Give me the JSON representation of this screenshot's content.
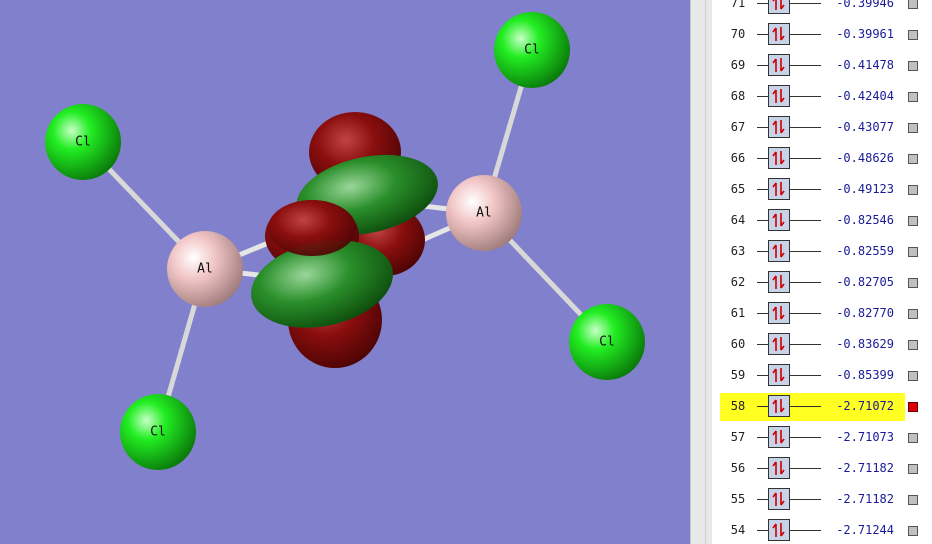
{
  "viewer": {
    "background": "#8080cc",
    "atoms": [
      {
        "id": "cl-top-left",
        "label": "Cl",
        "color": "green"
      },
      {
        "id": "cl-top-right",
        "label": "Cl",
        "color": "green"
      },
      {
        "id": "al-left",
        "label": "Al",
        "color": "pink"
      },
      {
        "id": "al-right",
        "label": "Al",
        "color": "pink"
      },
      {
        "id": "cl-bottom-right",
        "label": "Cl",
        "color": "green"
      },
      {
        "id": "cl-bottom-left",
        "label": "Cl",
        "color": "green"
      }
    ],
    "orbital_colors": {
      "positive": "#7a0a0a",
      "negative": "#1f7a1f"
    }
  },
  "orbital_list": {
    "occupancy_icon": "spin-pair-up-down-icon",
    "selected_color": "#ffff22",
    "rows": [
      {
        "number": "71",
        "energy": "-0.39946",
        "selected": false
      },
      {
        "number": "70",
        "energy": "-0.39961",
        "selected": false
      },
      {
        "number": "69",
        "energy": "-0.41478",
        "selected": false
      },
      {
        "number": "68",
        "energy": "-0.42404",
        "selected": false
      },
      {
        "number": "67",
        "energy": "-0.43077",
        "selected": false
      },
      {
        "number": "66",
        "energy": "-0.48626",
        "selected": false
      },
      {
        "number": "65",
        "energy": "-0.49123",
        "selected": false
      },
      {
        "number": "64",
        "energy": "-0.82546",
        "selected": false
      },
      {
        "number": "63",
        "energy": "-0.82559",
        "selected": false
      },
      {
        "number": "62",
        "energy": "-0.82705",
        "selected": false
      },
      {
        "number": "61",
        "energy": "-0.82770",
        "selected": false
      },
      {
        "number": "60",
        "energy": "-0.83629",
        "selected": false
      },
      {
        "number": "59",
        "energy": "-0.85399",
        "selected": false
      },
      {
        "number": "58",
        "energy": "-2.71072",
        "selected": true
      },
      {
        "number": "57",
        "energy": "-2.71073",
        "selected": false
      },
      {
        "number": "56",
        "energy": "-2.71182",
        "selected": false
      },
      {
        "number": "55",
        "energy": "-2.71182",
        "selected": false
      },
      {
        "number": "54",
        "energy": "-2.71244",
        "selected": false
      }
    ]
  }
}
